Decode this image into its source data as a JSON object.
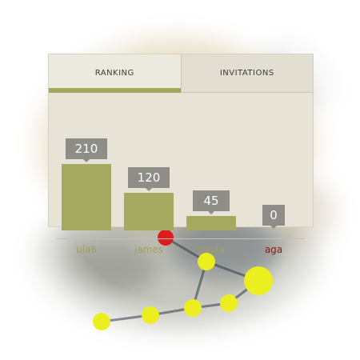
{
  "tabs": [
    {
      "label": "RANKING",
      "active": true
    },
    {
      "label": "INVITATIONS",
      "active": false
    }
  ],
  "ranking": [
    {
      "name": "ula6",
      "value": 210
    },
    {
      "name": "james",
      "value": 120
    },
    {
      "name": "paula",
      "value": 45
    },
    {
      "name": "aga",
      "value": 0
    }
  ],
  "colors": {
    "card_bg": "#e7e3d6",
    "bar": "#a5aa60",
    "value_label_bg": "#8e8d87",
    "active_underline": "#a2a75e",
    "name_text": "#9ea15d",
    "zero_name_text": "#8c1a1a",
    "network_node": "#ecef1f",
    "network_node_alert": "#e01b1b"
  }
}
